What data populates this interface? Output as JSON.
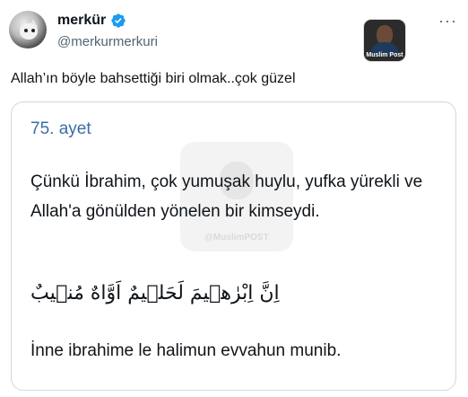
{
  "user": {
    "name": "merkür",
    "handle": "@merkurmerkuri"
  },
  "tweet": {
    "text": "Allah’ın böyle bahsettiği biri olmak..çok güzel"
  },
  "channel_badge": {
    "label": "Muslim Post"
  },
  "card": {
    "ayet_label": "75. ayet",
    "meaning": "Çünkü İbrahim, çok yumuşak huylu, yufka yürekli ve Allah'a gönülden yönelen bir kimseydi.",
    "arabic": "اِنَّ اِبْرٰهٖيمَ لَحَلٖيمٌ اَوَّاهٌ مُنٖيبٌ",
    "transliteration": "İnne ibrahime le halimun evvahun munib.",
    "watermark_text": "@MuslimPOST"
  },
  "colors": {
    "ayet_label": "#3a6ea5",
    "verified": "#1d9bf0",
    "secondary_text": "#536471"
  },
  "icons": {
    "verified": "verified-badge-icon",
    "more": "more-options-icon"
  }
}
